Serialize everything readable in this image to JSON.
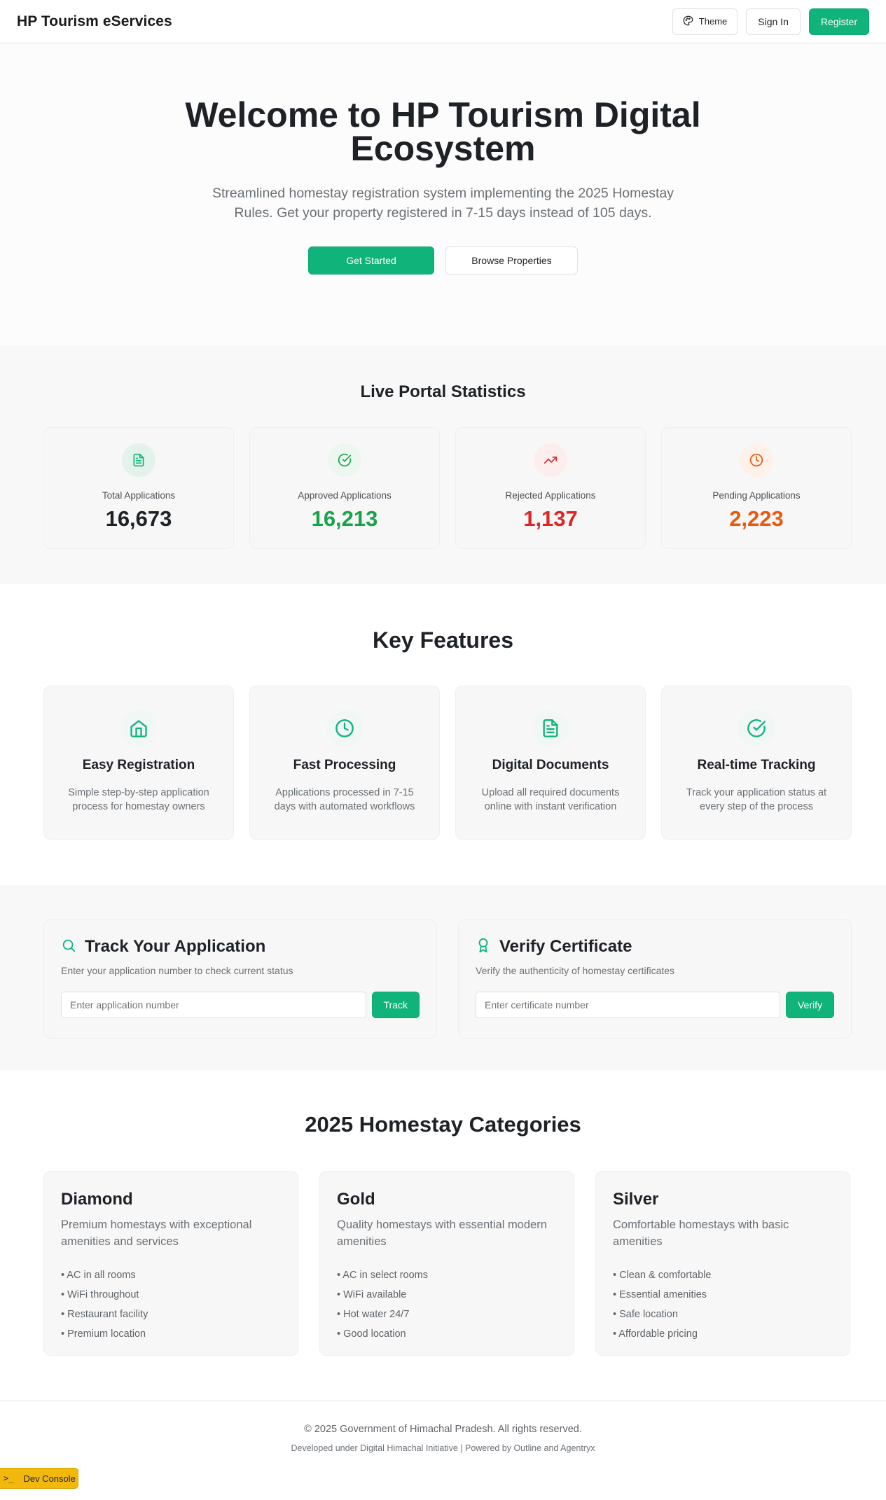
{
  "header": {
    "brand": "HP Tourism eServices",
    "theme_label": "Theme",
    "signin_label": "Sign In",
    "register_label": "Register"
  },
  "hero": {
    "title": "Welcome to HP Tourism Digital Ecosystem",
    "subtitle": "Streamlined homestay registration system implementing the 2025 Homestay Rules. Get your property registered in 7-15 days instead of 105 days.",
    "get_started_label": "Get Started",
    "browse_label": "Browse Properties"
  },
  "stats": {
    "title": "Live Portal Statistics",
    "items": [
      {
        "label": "Total Applications",
        "value": "16,673",
        "color": "#1e2126",
        "icon": "document-icon"
      },
      {
        "label": "Approved Applications",
        "value": "16,213",
        "color": "#16a34a",
        "icon": "check-circle-icon"
      },
      {
        "label": "Rejected Applications",
        "value": "1,137",
        "color": "#dc2626",
        "icon": "trending-up-icon"
      },
      {
        "label": "Pending Applications",
        "value": "2,223",
        "color": "#ea580c",
        "icon": "clock-icon"
      }
    ]
  },
  "features": {
    "title": "Key Features",
    "items": [
      {
        "title": "Easy Registration",
        "desc": "Simple step-by-step application process for homestay owners",
        "icon": "home-icon"
      },
      {
        "title": "Fast Processing",
        "desc": "Applications processed in 7-15 days with automated workflows",
        "icon": "clock-icon"
      },
      {
        "title": "Digital Documents",
        "desc": "Upload all required documents online with instant verification",
        "icon": "document-icon"
      },
      {
        "title": "Real-time Tracking",
        "desc": "Track your application status at every step of the process",
        "icon": "check-circle-icon"
      }
    ]
  },
  "track": {
    "title": "Track Your Application",
    "subtitle": "Enter your application number to check current status",
    "placeholder": "Enter application number",
    "button": "Track"
  },
  "verify": {
    "title": "Verify Certificate",
    "subtitle": "Verify the authenticity of homestay certificates",
    "placeholder": "Enter certificate number",
    "button": "Verify"
  },
  "categories": {
    "title": "2025 Homestay Categories",
    "items": [
      {
        "name": "Diamond",
        "desc": "Premium homestays with exceptional amenities and services",
        "features": [
          "• AC in all rooms",
          "• WiFi throughout",
          "• Restaurant facility",
          "• Premium location"
        ]
      },
      {
        "name": "Gold",
        "desc": "Quality homestays with essential modern amenities",
        "features": [
          "• AC in select rooms",
          "• WiFi available",
          "• Hot water 24/7",
          "• Good location"
        ]
      },
      {
        "name": "Silver",
        "desc": "Comfortable homestays with basic amenities",
        "features": [
          "• Clean & comfortable",
          "• Essential amenities",
          "• Safe location",
          "• Affordable pricing"
        ]
      }
    ]
  },
  "footer": {
    "copyright": "© 2025 Government of Himachal Pradesh. All rights reserved.",
    "credit": "Developed under Digital Himachal Initiative | Powered by Outline and Agentryx"
  },
  "dev_console": {
    "label": "Dev Console",
    "glyph": ">_"
  },
  "colors": {
    "accent": "#10b47b"
  }
}
